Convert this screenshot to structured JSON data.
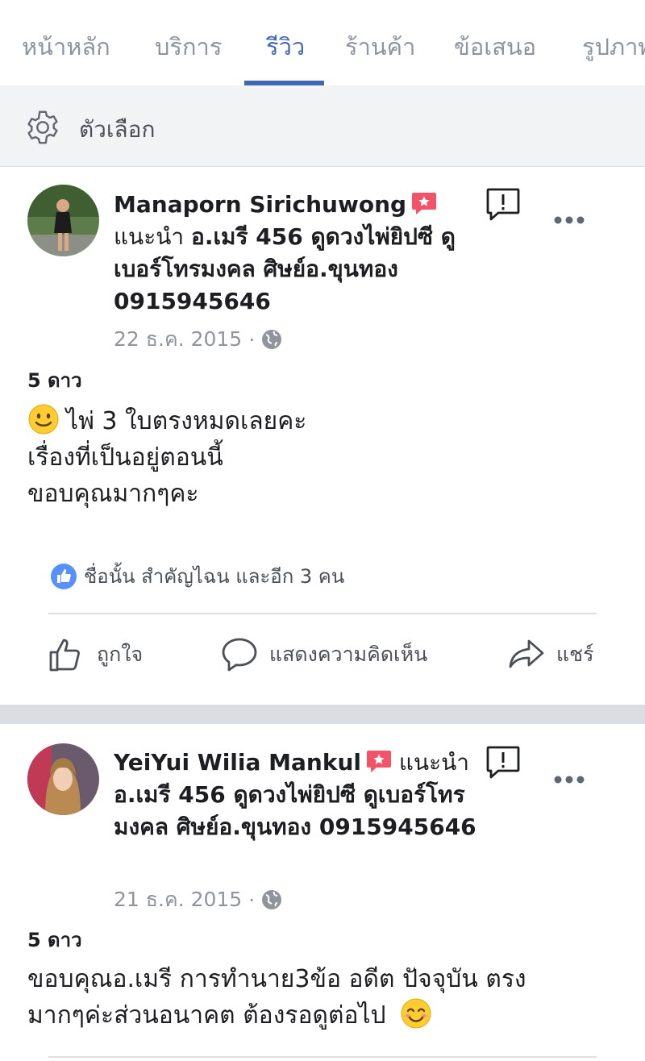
{
  "tabs": [
    {
      "label": "หน้าหลัก"
    },
    {
      "label": "บริการ"
    },
    {
      "label": "รีวิว"
    },
    {
      "label": "ร้านค้า"
    },
    {
      "label": "ข้อเสนอ"
    },
    {
      "label": "รูปภาพ"
    }
  ],
  "active_tab": "รีวิว",
  "options": {
    "label": "ตัวเลือก"
  },
  "reviews": [
    {
      "author": "Manaporn Sirichuwong",
      "verb": "แนะนำ",
      "page": "อ.เมรี 456 ดูดวงไพ่ยิปซี ดูเบอร์โทรมงคล ศิษย์อ.ขุนทอง 0915945646",
      "date": "22 ธ.ค. 2015",
      "separator": "·",
      "stars": "5 ดาว",
      "text_lines": [
        "ไพ่ 3 ใบตรงหมดเลยคะ",
        "เรื่องที่เป็นอยู่ตอนนี้",
        "ขอบคุณมากๆคะ"
      ],
      "emoji": "slightly-smiling-face",
      "likes": "ชื่อนั้น สำคัญไฉน และอีก 3 คน",
      "actions": {
        "like": "ถูกใจ",
        "comment": "แสดงความคิดเห็น",
        "share": "แชร์"
      }
    },
    {
      "author": "YeiYui Wilia Mankul",
      "verb": "แนะนำ",
      "page": "อ.เมรี 456 ดูดวงไพ่ยิปซี ดูเบอร์โทรมงคล ศิษย์อ.ขุนทอง 0915945646",
      "date": "21 ธ.ค. 2015",
      "separator": "·",
      "stars": "5 ดาว",
      "text_lines": [
        "ขอบคุณอ.เมรี การทำนาย3ข้อ อดีต ปัจจุบัน ตรง",
        "มากๆค่ะส่วนอนาคต ต้องรอดูต่อไป"
      ],
      "emoji": "smiling-face-with-smiling-eyes"
    }
  ],
  "colors": {
    "accent": "#4267b2",
    "inactive_tab": "#8d949e",
    "recommend_badge": "#f35369",
    "like_badge": "#5890ff",
    "options_bg": "#f2f3f5",
    "separator": "#dadde1"
  }
}
